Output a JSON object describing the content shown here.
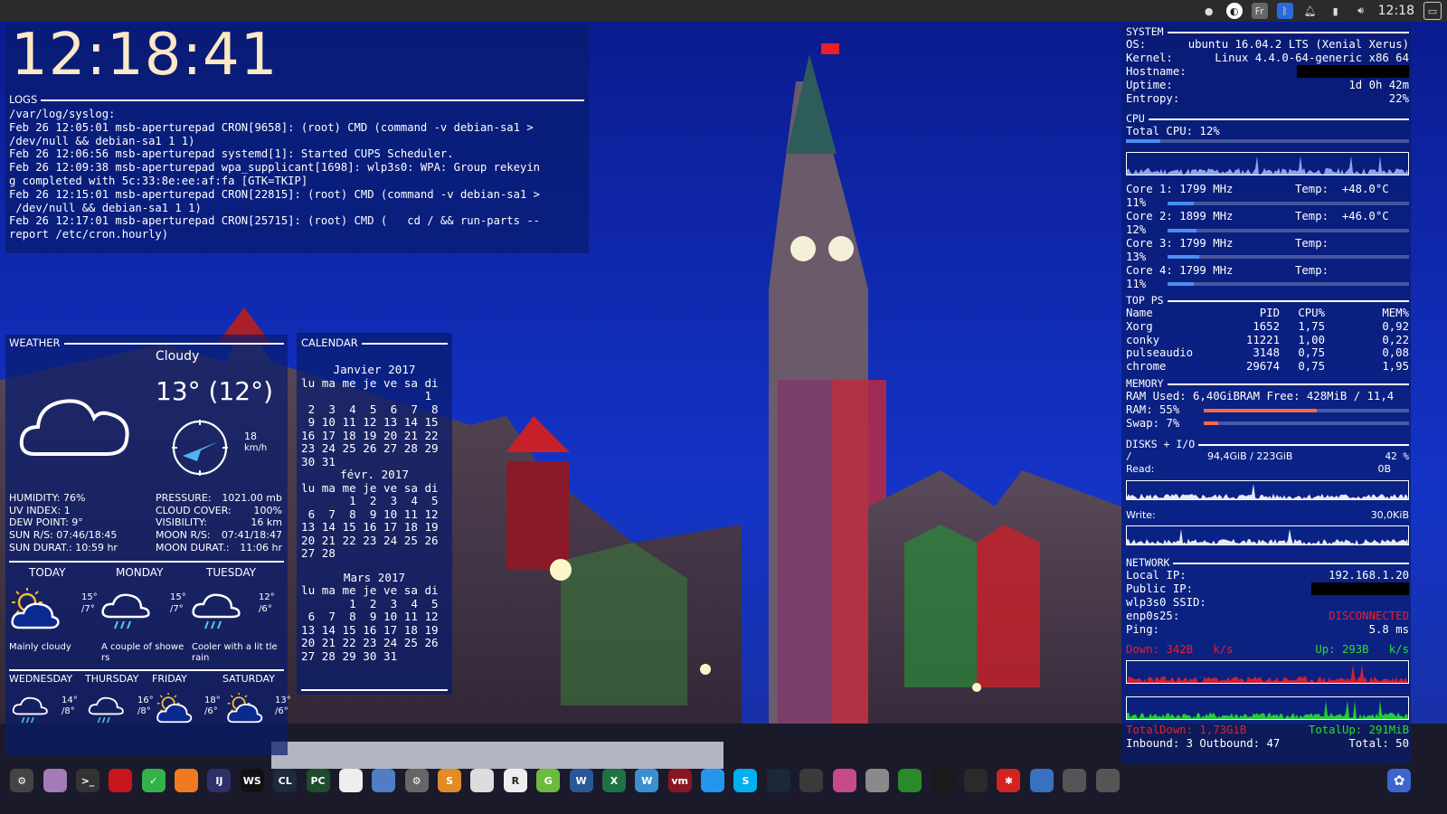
{
  "top_panel": {
    "time": "12:18",
    "tray_icons": [
      "steam-icon",
      "language-icon",
      "bluetooth-icon",
      "notification-bell-icon",
      "battery-icon",
      "volume-icon",
      "window-icon"
    ],
    "language_label": "Fr"
  },
  "clock": {
    "time": "12:18:41"
  },
  "logs": {
    "title": "LOGS",
    "lines": [
      "/var/log/syslog:",
      "Feb 26 12:05:01 msb-aperturepad CRON[9658]: (root) CMD (command -v debian-sa1 >",
      "/dev/null && debian-sa1 1 1)",
      "Feb 26 12:06:56 msb-aperturepad systemd[1]: Started CUPS Scheduler.",
      "Feb 26 12:09:38 msb-aperturepad wpa_supplicant[1698]: wlp3s0: WPA: Group rekeyin",
      "g completed with 5c:33:8e:ee:af:fa [GTK=TKIP]",
      "Feb 26 12:15:01 msb-aperturepad CRON[22815]: (root) CMD (command -v debian-sa1 >",
      " /dev/null && debian-sa1 1 1)",
      "Feb 26 12:17:01 msb-aperturepad CRON[25715]: (root) CMD (   cd / && run-parts --",
      "report /etc/cron.hourly)"
    ]
  },
  "weather": {
    "title": "WEATHER",
    "condition": "Cloudy",
    "temperature": "13° (12°)",
    "wind_speed": "18",
    "wind_unit": "km/h",
    "left_stats": [
      "HUMIDITY: 76%",
      "UV INDEX: 1",
      "DEW POINT: 9°",
      "SUN R/S: 07:46/18:45",
      "SUN DURAT.: 10:59 hr"
    ],
    "right_labels": [
      "PRESSURE:",
      "CLOUD COVER:",
      "VISIBILITY:",
      "MOON R/S:",
      "MOON DURAT.:"
    ],
    "right_values": [
      "1021.00 mb",
      "100%",
      "16 km",
      "07:41/18:47",
      "11:06 hr"
    ],
    "forecast": [
      {
        "day": "TODAY",
        "high": "15°",
        "low": "/7°",
        "desc": "Mainly cloudy",
        "icon": "sun-cloud-icon"
      },
      {
        "day": "MONDAY",
        "high": "15°",
        "low": "/7°",
        "desc": "A couple of showe rs",
        "icon": "rain-cloud-icon"
      },
      {
        "day": "TUESDAY",
        "high": "12°",
        "low": "/6°",
        "desc": "Cooler with a lit tle rain",
        "icon": "rain-cloud-icon"
      }
    ],
    "forecast2": [
      {
        "day": "WEDNESDAY",
        "high": "14°",
        "low": "/8°",
        "icon": "rain-cloud-icon"
      },
      {
        "day": "THURSDAY",
        "high": "16°",
        "low": "/8°",
        "icon": "rain-cloud-icon"
      },
      {
        "day": "FRIDAY",
        "high": "18°",
        "low": "/6°",
        "icon": "sun-cloud-icon"
      },
      {
        "day": "SATURDAY",
        "high": "13°",
        "low": "/6°",
        "icon": "sun-cloud-icon"
      }
    ]
  },
  "calendar": {
    "title": "CALENDAR",
    "months": [
      {
        "name": "Janvier 2017",
        "header": "lu ma me je ve sa di",
        "weeks": [
          "                  1",
          " 2  3  4  5  6  7  8",
          " 9 10 11 12 13 14 15",
          "16 17 18 19 20 21 22",
          "23 24 25 26 27 28 29",
          "30 31"
        ]
      },
      {
        "name": "févr. 2017",
        "header": "lu ma me je ve sa di",
        "weeks": [
          "       1  2  3  4  5",
          " 6  7  8  9 10 11 12",
          "13 14 15 16 17 18 19",
          "20 21 22 23 24 25 26",
          "27 28"
        ]
      },
      {
        "name": "Mars 2017",
        "header": "lu ma me je ve sa di",
        "weeks": [
          "       1  2  3  4  5",
          " 6  7  8  9 10 11 12",
          "13 14 15 16 17 18 19",
          "20 21 22 23 24 25 26",
          "27 28 29 30 31"
        ]
      }
    ]
  },
  "system": {
    "title": "SYSTEM",
    "rows": [
      {
        "label": "OS:",
        "value": "ubuntu 16.04.2 LTS (Xenial Xerus)"
      },
      {
        "label": "Kernel:",
        "value": "Linux 4.4.0-64-generic x86 64"
      },
      {
        "label": "Hostname:",
        "value": ""
      },
      {
        "label": "Uptime:",
        "value": "1d 0h 42m"
      },
      {
        "label": "Entropy:",
        "value": "22%"
      }
    ]
  },
  "cpu": {
    "title": "CPU",
    "total": "Total CPU: 12%",
    "total_pct": 12,
    "cores": [
      {
        "name": "Core 1: 1799 MHz",
        "temp": "Temp:  +48.0°C",
        "pct_label": "11%",
        "pct": 11
      },
      {
        "name": "Core 2: 1899 MHz",
        "temp": "Temp:  +46.0°C",
        "pct_label": "12%",
        "pct": 12
      },
      {
        "name": "Core 3: 1799 MHz",
        "temp": "Temp:",
        "pct_label": "13%",
        "pct": 13
      },
      {
        "name": "Core 4: 1799 MHz",
        "temp": "Temp:",
        "pct_label": "11%",
        "pct": 11
      }
    ]
  },
  "top_ps": {
    "title": "TOP PS",
    "headers": [
      "Name",
      "PID",
      "CPU%",
      "MEM%"
    ],
    "rows": [
      [
        "Xorg",
        "1652",
        "1,75",
        "0,92"
      ],
      [
        "conky",
        "11221",
        "1,00",
        "0,22"
      ],
      [
        "pulseaudio",
        "3148",
        "0,75",
        "0,08"
      ],
      [
        "chrome",
        "29674",
        "0,75",
        "1,95"
      ]
    ]
  },
  "memory": {
    "title": "MEMORY",
    "summary": "RAM Used: 6,40GiBRAM Free: 428MiB / 11,4",
    "ram_label": "RAM: 55%",
    "ram_pct": 55,
    "swap_label": "Swap: 7%",
    "swap_pct": 7
  },
  "disks": {
    "title": "DISKS + I/O",
    "mount": "/",
    "usage": "94,4GiB / 223GiB",
    "usage_pct_label": "42 %",
    "read_label": "Read:",
    "read_value": "0B",
    "write_label": "Write:",
    "write_value": "30,0KiB"
  },
  "network": {
    "title": "NETWORK",
    "local_ip_label": "Local IP:",
    "local_ip": "192.168.1.20",
    "public_ip_label": "Public IP:",
    "ssid_label": "wlp3s0 SSID:",
    "enp_label": "enp0s25:",
    "enp_value": "DISCONNECTED",
    "ping_label": "Ping:",
    "ping_value": "5.8 ms",
    "down_label": "Down: 342B",
    "down_unit": "k/s",
    "up_label": "Up: 293B",
    "up_unit": "k/s",
    "total_down": "TotalDown: 1,73GiB",
    "total_up": "TotalUp: 291MiB",
    "inbound_outbound": "Inbound: 3 Outbound: 47",
    "total": "Total: 50",
    "down_color": "#e8202a",
    "up_color": "#25e02a"
  },
  "dock": {
    "icons": [
      {
        "name": "launcher-icon",
        "color": "#444",
        "label": "⚙"
      },
      {
        "name": "files-icon",
        "color": "#a27bb8",
        "label": ""
      },
      {
        "name": "terminal-icon",
        "color": "#333",
        "label": ">_"
      },
      {
        "name": "screenshot-tool-icon",
        "color": "#c8161d",
        "label": ""
      },
      {
        "name": "vpn-shield-icon",
        "color": "#33b24a",
        "label": "✓"
      },
      {
        "name": "firefox-icon",
        "color": "#f07a22",
        "label": ""
      },
      {
        "name": "intellij-icon",
        "color": "#2f2f6a",
        "label": "IJ"
      },
      {
        "name": "webstorm-icon",
        "color": "#111",
        "label": "WS"
      },
      {
        "name": "clion-icon",
        "color": "#1c2a3a",
        "label": "CL"
      },
      {
        "name": "pycharm-icon",
        "color": "#1d4d2a",
        "label": "PC"
      },
      {
        "name": "linux-tux-icon",
        "color": "#eee",
        "label": ""
      },
      {
        "name": "chat-icon",
        "color": "#4f7ec4",
        "label": ""
      },
      {
        "name": "settings-gear-icon",
        "color": "#666",
        "label": "⚙"
      },
      {
        "name": "sublime-icon",
        "color": "#e38b24",
        "label": "S"
      },
      {
        "name": "notes-icon",
        "color": "#ddd",
        "label": ""
      },
      {
        "name": "r-studio-icon",
        "color": "#eee",
        "label": "R"
      },
      {
        "name": "green-app-icon",
        "color": "#6dbb3c",
        "label": "G"
      },
      {
        "name": "word-icon",
        "color": "#2b5797",
        "label": "W"
      },
      {
        "name": "excel-icon",
        "color": "#1f7244",
        "label": "X"
      },
      {
        "name": "wps-icon",
        "color": "#3a8fd0",
        "label": "W"
      },
      {
        "name": "vmware-icon",
        "color": "#8a1624",
        "label": "vm"
      },
      {
        "name": "docker-icon",
        "color": "#2496ed",
        "label": ""
      },
      {
        "name": "skype-icon",
        "color": "#00aff0",
        "label": "S"
      },
      {
        "name": "steam-icon",
        "color": "#1b2838",
        "label": ""
      },
      {
        "name": "calculator-icon",
        "color": "#3a3a3a",
        "label": ""
      },
      {
        "name": "toggle-icon",
        "color": "#c64a8a",
        "label": ""
      },
      {
        "name": "archive-icon",
        "color": "#8a8a8a",
        "label": ""
      },
      {
        "name": "gpu-card-icon",
        "color": "#2a8a2a",
        "label": ""
      },
      {
        "name": "system-monitor-icon",
        "color": "#1a1a1a",
        "label": ""
      },
      {
        "name": "update-icon",
        "color": "#2a2a2a",
        "label": ""
      },
      {
        "name": "red-star-icon",
        "color": "#d42222",
        "label": "✱"
      },
      {
        "name": "screen-icon",
        "color": "#3a70c0",
        "label": ""
      },
      {
        "name": "camera-icon",
        "color": "#555",
        "label": ""
      },
      {
        "name": "camera2-icon",
        "color": "#555",
        "label": ""
      }
    ],
    "right_icon": {
      "name": "settings-flower-icon",
      "color": "#3b66d0"
    }
  }
}
